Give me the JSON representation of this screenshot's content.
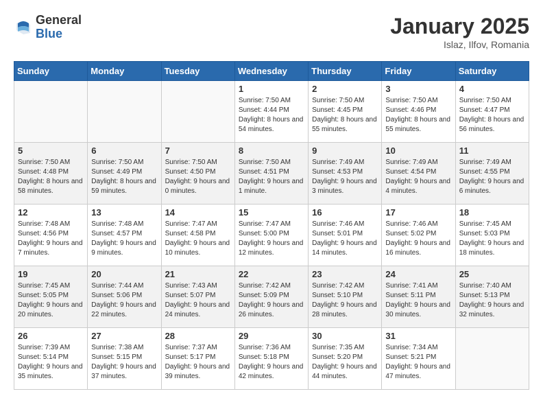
{
  "header": {
    "logo": {
      "general": "General",
      "blue": "Blue"
    },
    "title": "January 2025",
    "location": "Islaz, Ilfov, Romania"
  },
  "weekdays": [
    "Sunday",
    "Monday",
    "Tuesday",
    "Wednesday",
    "Thursday",
    "Friday",
    "Saturday"
  ],
  "weeks": [
    {
      "shaded": false,
      "days": [
        {
          "num": "",
          "info": ""
        },
        {
          "num": "",
          "info": ""
        },
        {
          "num": "",
          "info": ""
        },
        {
          "num": "1",
          "info": "Sunrise: 7:50 AM\nSunset: 4:44 PM\nDaylight: 8 hours\nand 54 minutes."
        },
        {
          "num": "2",
          "info": "Sunrise: 7:50 AM\nSunset: 4:45 PM\nDaylight: 8 hours\nand 55 minutes."
        },
        {
          "num": "3",
          "info": "Sunrise: 7:50 AM\nSunset: 4:46 PM\nDaylight: 8 hours\nand 55 minutes."
        },
        {
          "num": "4",
          "info": "Sunrise: 7:50 AM\nSunset: 4:47 PM\nDaylight: 8 hours\nand 56 minutes."
        }
      ]
    },
    {
      "shaded": true,
      "days": [
        {
          "num": "5",
          "info": "Sunrise: 7:50 AM\nSunset: 4:48 PM\nDaylight: 8 hours\nand 58 minutes."
        },
        {
          "num": "6",
          "info": "Sunrise: 7:50 AM\nSunset: 4:49 PM\nDaylight: 8 hours\nand 59 minutes."
        },
        {
          "num": "7",
          "info": "Sunrise: 7:50 AM\nSunset: 4:50 PM\nDaylight: 9 hours\nand 0 minutes."
        },
        {
          "num": "8",
          "info": "Sunrise: 7:50 AM\nSunset: 4:51 PM\nDaylight: 9 hours\nand 1 minute."
        },
        {
          "num": "9",
          "info": "Sunrise: 7:49 AM\nSunset: 4:53 PM\nDaylight: 9 hours\nand 3 minutes."
        },
        {
          "num": "10",
          "info": "Sunrise: 7:49 AM\nSunset: 4:54 PM\nDaylight: 9 hours\nand 4 minutes."
        },
        {
          "num": "11",
          "info": "Sunrise: 7:49 AM\nSunset: 4:55 PM\nDaylight: 9 hours\nand 6 minutes."
        }
      ]
    },
    {
      "shaded": false,
      "days": [
        {
          "num": "12",
          "info": "Sunrise: 7:48 AM\nSunset: 4:56 PM\nDaylight: 9 hours\nand 7 minutes."
        },
        {
          "num": "13",
          "info": "Sunrise: 7:48 AM\nSunset: 4:57 PM\nDaylight: 9 hours\nand 9 minutes."
        },
        {
          "num": "14",
          "info": "Sunrise: 7:47 AM\nSunset: 4:58 PM\nDaylight: 9 hours\nand 10 minutes."
        },
        {
          "num": "15",
          "info": "Sunrise: 7:47 AM\nSunset: 5:00 PM\nDaylight: 9 hours\nand 12 minutes."
        },
        {
          "num": "16",
          "info": "Sunrise: 7:46 AM\nSunset: 5:01 PM\nDaylight: 9 hours\nand 14 minutes."
        },
        {
          "num": "17",
          "info": "Sunrise: 7:46 AM\nSunset: 5:02 PM\nDaylight: 9 hours\nand 16 minutes."
        },
        {
          "num": "18",
          "info": "Sunrise: 7:45 AM\nSunset: 5:03 PM\nDaylight: 9 hours\nand 18 minutes."
        }
      ]
    },
    {
      "shaded": true,
      "days": [
        {
          "num": "19",
          "info": "Sunrise: 7:45 AM\nSunset: 5:05 PM\nDaylight: 9 hours\nand 20 minutes."
        },
        {
          "num": "20",
          "info": "Sunrise: 7:44 AM\nSunset: 5:06 PM\nDaylight: 9 hours\nand 22 minutes."
        },
        {
          "num": "21",
          "info": "Sunrise: 7:43 AM\nSunset: 5:07 PM\nDaylight: 9 hours\nand 24 minutes."
        },
        {
          "num": "22",
          "info": "Sunrise: 7:42 AM\nSunset: 5:09 PM\nDaylight: 9 hours\nand 26 minutes."
        },
        {
          "num": "23",
          "info": "Sunrise: 7:42 AM\nSunset: 5:10 PM\nDaylight: 9 hours\nand 28 minutes."
        },
        {
          "num": "24",
          "info": "Sunrise: 7:41 AM\nSunset: 5:11 PM\nDaylight: 9 hours\nand 30 minutes."
        },
        {
          "num": "25",
          "info": "Sunrise: 7:40 AM\nSunset: 5:13 PM\nDaylight: 9 hours\nand 32 minutes."
        }
      ]
    },
    {
      "shaded": false,
      "days": [
        {
          "num": "26",
          "info": "Sunrise: 7:39 AM\nSunset: 5:14 PM\nDaylight: 9 hours\nand 35 minutes."
        },
        {
          "num": "27",
          "info": "Sunrise: 7:38 AM\nSunset: 5:15 PM\nDaylight: 9 hours\nand 37 minutes."
        },
        {
          "num": "28",
          "info": "Sunrise: 7:37 AM\nSunset: 5:17 PM\nDaylight: 9 hours\nand 39 minutes."
        },
        {
          "num": "29",
          "info": "Sunrise: 7:36 AM\nSunset: 5:18 PM\nDaylight: 9 hours\nand 42 minutes."
        },
        {
          "num": "30",
          "info": "Sunrise: 7:35 AM\nSunset: 5:20 PM\nDaylight: 9 hours\nand 44 minutes."
        },
        {
          "num": "31",
          "info": "Sunrise: 7:34 AM\nSunset: 5:21 PM\nDaylight: 9 hours\nand 47 minutes."
        },
        {
          "num": "",
          "info": ""
        }
      ]
    }
  ]
}
